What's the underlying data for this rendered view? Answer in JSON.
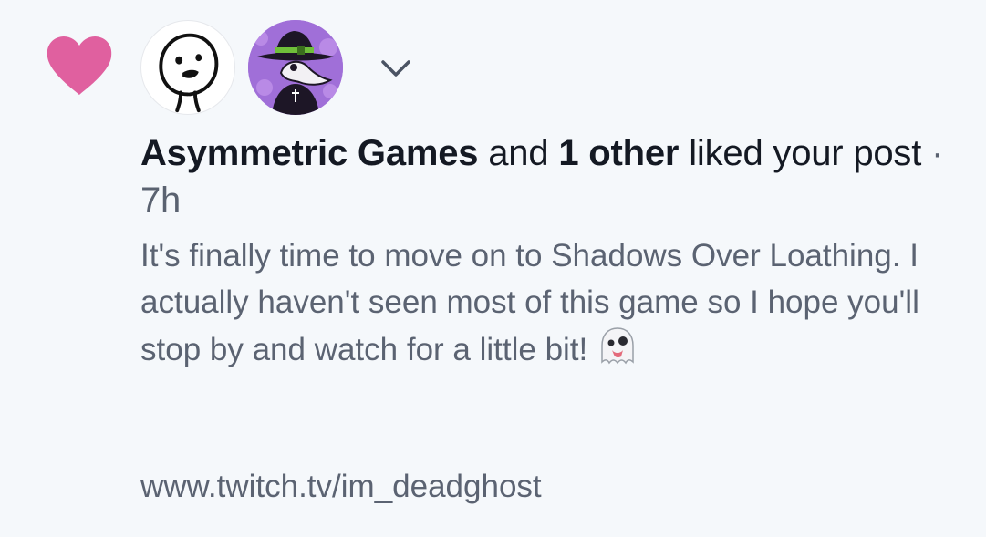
{
  "notification": {
    "actor_name": "Asymmetric Games",
    "connector": "and",
    "others": "1 other",
    "action": "liked your post",
    "separator": "·",
    "time": "7h",
    "post_text": "It's finally time to move on to Shadows Over Loathing. I actually haven't seen most of this game so I hope you'll stop by and watch for a little bit!",
    "link": "www.twitch.tv/im_deadghost"
  },
  "icons": {
    "reaction": "heart-icon",
    "expand": "chevron-down-icon",
    "emoji": "ghost-icon"
  },
  "colors": {
    "background": "#f5f8fb",
    "heart": "#e0609f",
    "primary_text": "#141923",
    "secondary_text": "#5b6372",
    "chevron": "#4a5363"
  }
}
